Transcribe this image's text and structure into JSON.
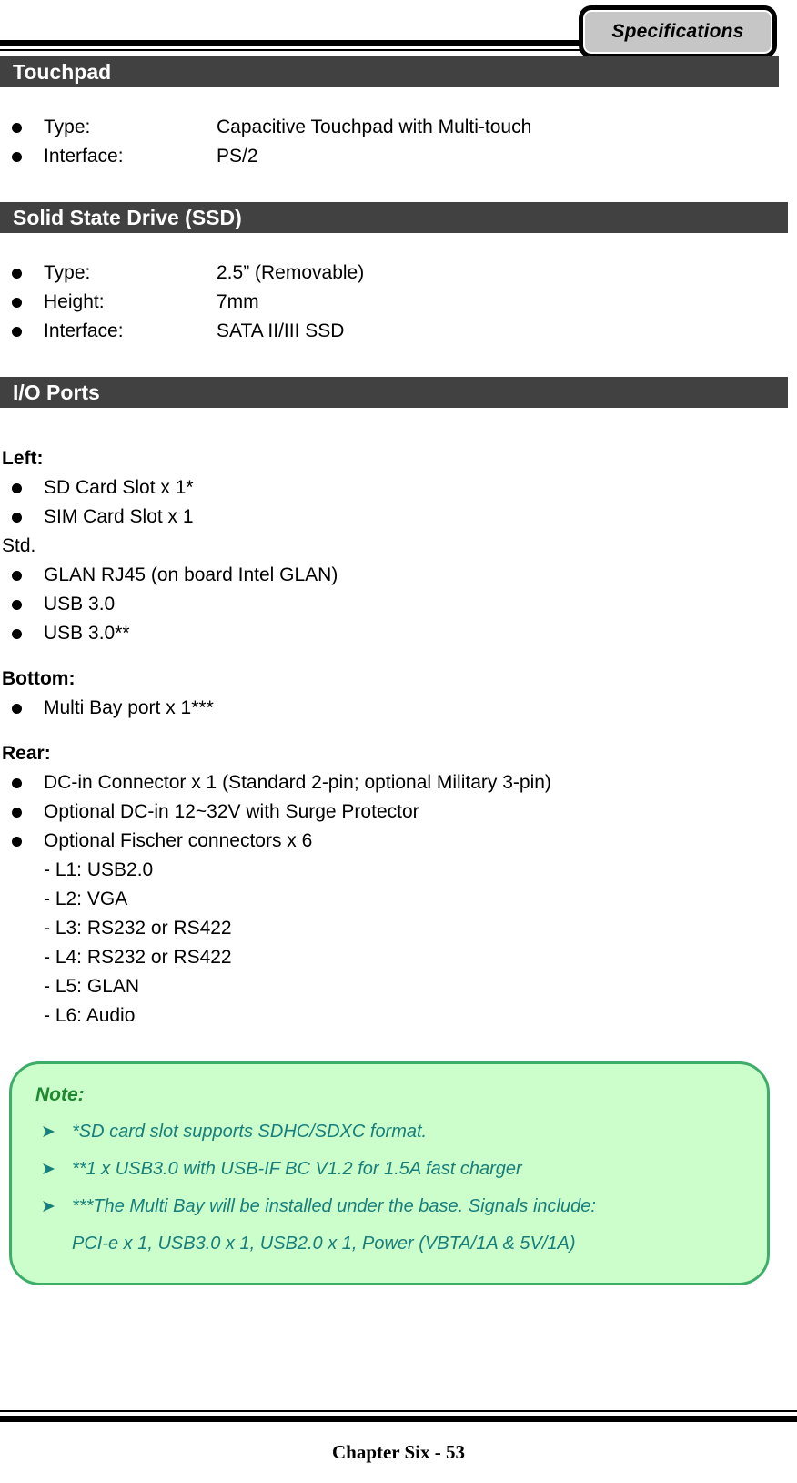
{
  "header": {
    "tab_label": "Specifications"
  },
  "sections": [
    {
      "title": "Touchpad",
      "items": [
        {
          "key": "Type:",
          "value": "Capacitive Touchpad with Multi-touch"
        },
        {
          "key": "Interface:",
          "value": "PS/2"
        }
      ]
    },
    {
      "title": "Solid State Drive (SSD)",
      "items": [
        {
          "key": "Type:",
          "value": "2.5” (Removable)"
        },
        {
          "key": "Height:",
          "value": "7mm"
        },
        {
          "key": "Interface:",
          "value": "SATA II/III SSD"
        }
      ]
    }
  ],
  "io_ports": {
    "title": "I/O Ports",
    "groups": [
      {
        "heading": "Left:",
        "bullets_before": [
          "SD Card Slot x 1*",
          "SIM Card Slot x 1"
        ],
        "plain_line": "Std.",
        "bullets_after": [
          "GLAN RJ45 (on board Intel GLAN)",
          "USB 3.0",
          "USB 3.0**"
        ]
      },
      {
        "heading": "Bottom:",
        "bullets_before": [
          "Multi Bay port x 1***"
        ]
      },
      {
        "heading": "Rear:",
        "bullets_before": [
          "DC-in Connector x 1 (Standard 2-pin; optional Military 3-pin)",
          "Optional DC-in 12~32V with Surge Protector",
          "Optional Fischer connectors x 6"
        ],
        "sub_items": [
          "- L1: USB2.0",
          "- L2: VGA",
          "- L3: RS232 or RS422",
          "- L4: RS232 or RS422",
          "- L5: GLAN",
          "- L6: Audio"
        ]
      }
    ]
  },
  "note": {
    "title": "Note:",
    "items": [
      "*SD card slot supports SDHC/SDXC format.",
      "**1 x USB3.0 with USB-IF BC V1.2 for 1.5A fast charger"
    ],
    "long_item_line1": "***The Multi Bay will be installed under the base. Signals include:",
    "long_item_line2": "PCI-e x 1, USB3.0 x 1, USB2.0 x 1, Power (VBTA/1A & 5V/1A)"
  },
  "footer": {
    "text": "Chapter Six - 53"
  },
  "colors": {
    "section_bar": "#414141",
    "note_fill": "#ccfecc",
    "note_border": "#3cae68",
    "note_title": "#1d8a2f",
    "note_text": "#177f7b",
    "tab_fill": "#c6c6c6"
  }
}
